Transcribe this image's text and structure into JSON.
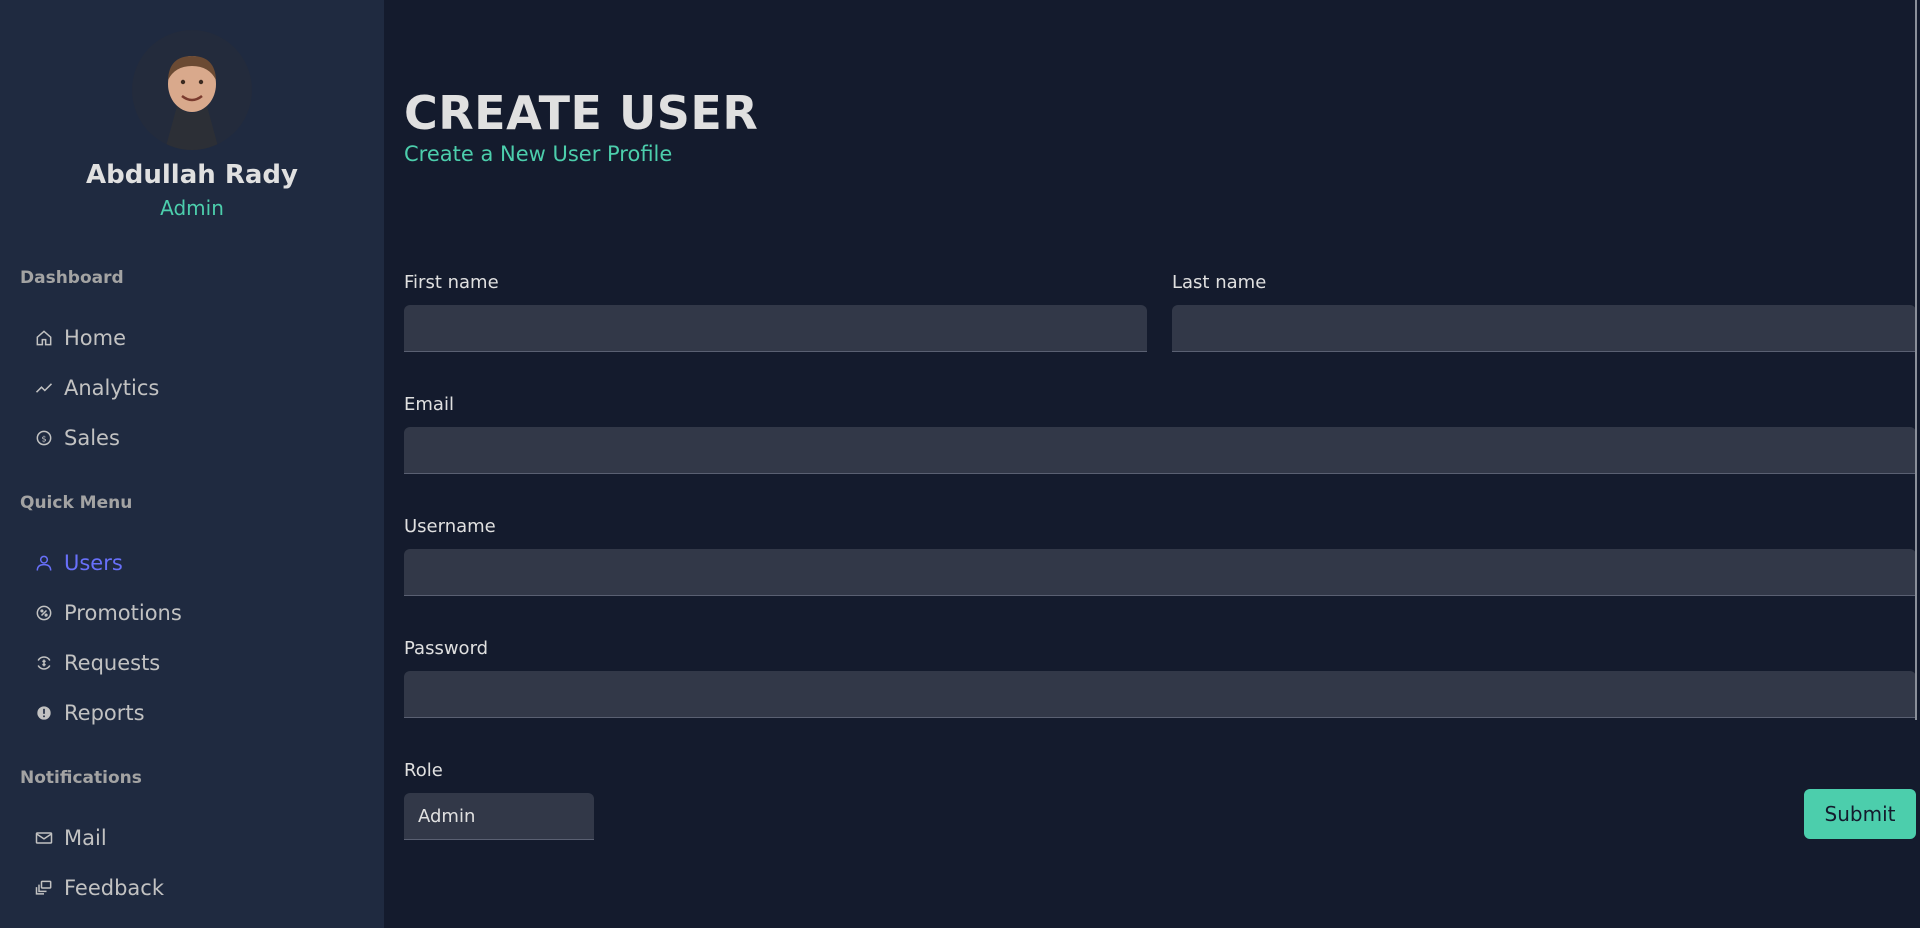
{
  "profile": {
    "name": "Abdullah Rady",
    "role": "Admin"
  },
  "sidebar": {
    "sections": [
      {
        "title": "Dashboard"
      },
      {
        "title": "Quick Menu"
      },
      {
        "title": "Notifications"
      }
    ],
    "items": [
      {
        "label": "Home",
        "icon": "home-icon"
      },
      {
        "label": "Analytics",
        "icon": "trend-icon"
      },
      {
        "label": "Sales",
        "icon": "dollar-icon"
      },
      {
        "label": "Users",
        "icon": "person-icon",
        "active": true
      },
      {
        "label": "Promotions",
        "icon": "badge-icon"
      },
      {
        "label": "Requests",
        "icon": "currency-exchange-icon"
      },
      {
        "label": "Reports",
        "icon": "alert-icon"
      },
      {
        "label": "Mail",
        "icon": "mail-icon"
      },
      {
        "label": "Feedback",
        "icon": "feedback-icon"
      }
    ]
  },
  "page": {
    "title": "CREATE USER",
    "subtitle": "Create a New User Profile"
  },
  "form": {
    "first_name_label": "First name",
    "first_name_value": "",
    "last_name_label": "Last name",
    "last_name_value": "",
    "email_label": "Email",
    "email_value": "",
    "username_label": "Username",
    "username_value": "",
    "password_label": "Password",
    "password_value": "",
    "role_label": "Role",
    "role_value": "Admin",
    "submit_label": "Submit"
  },
  "colors": {
    "background": "#141b2d",
    "sidebar": "#1f2a40",
    "accent_green": "#4cceac",
    "accent_blue": "#6870fa",
    "input_bg": "#323848"
  }
}
